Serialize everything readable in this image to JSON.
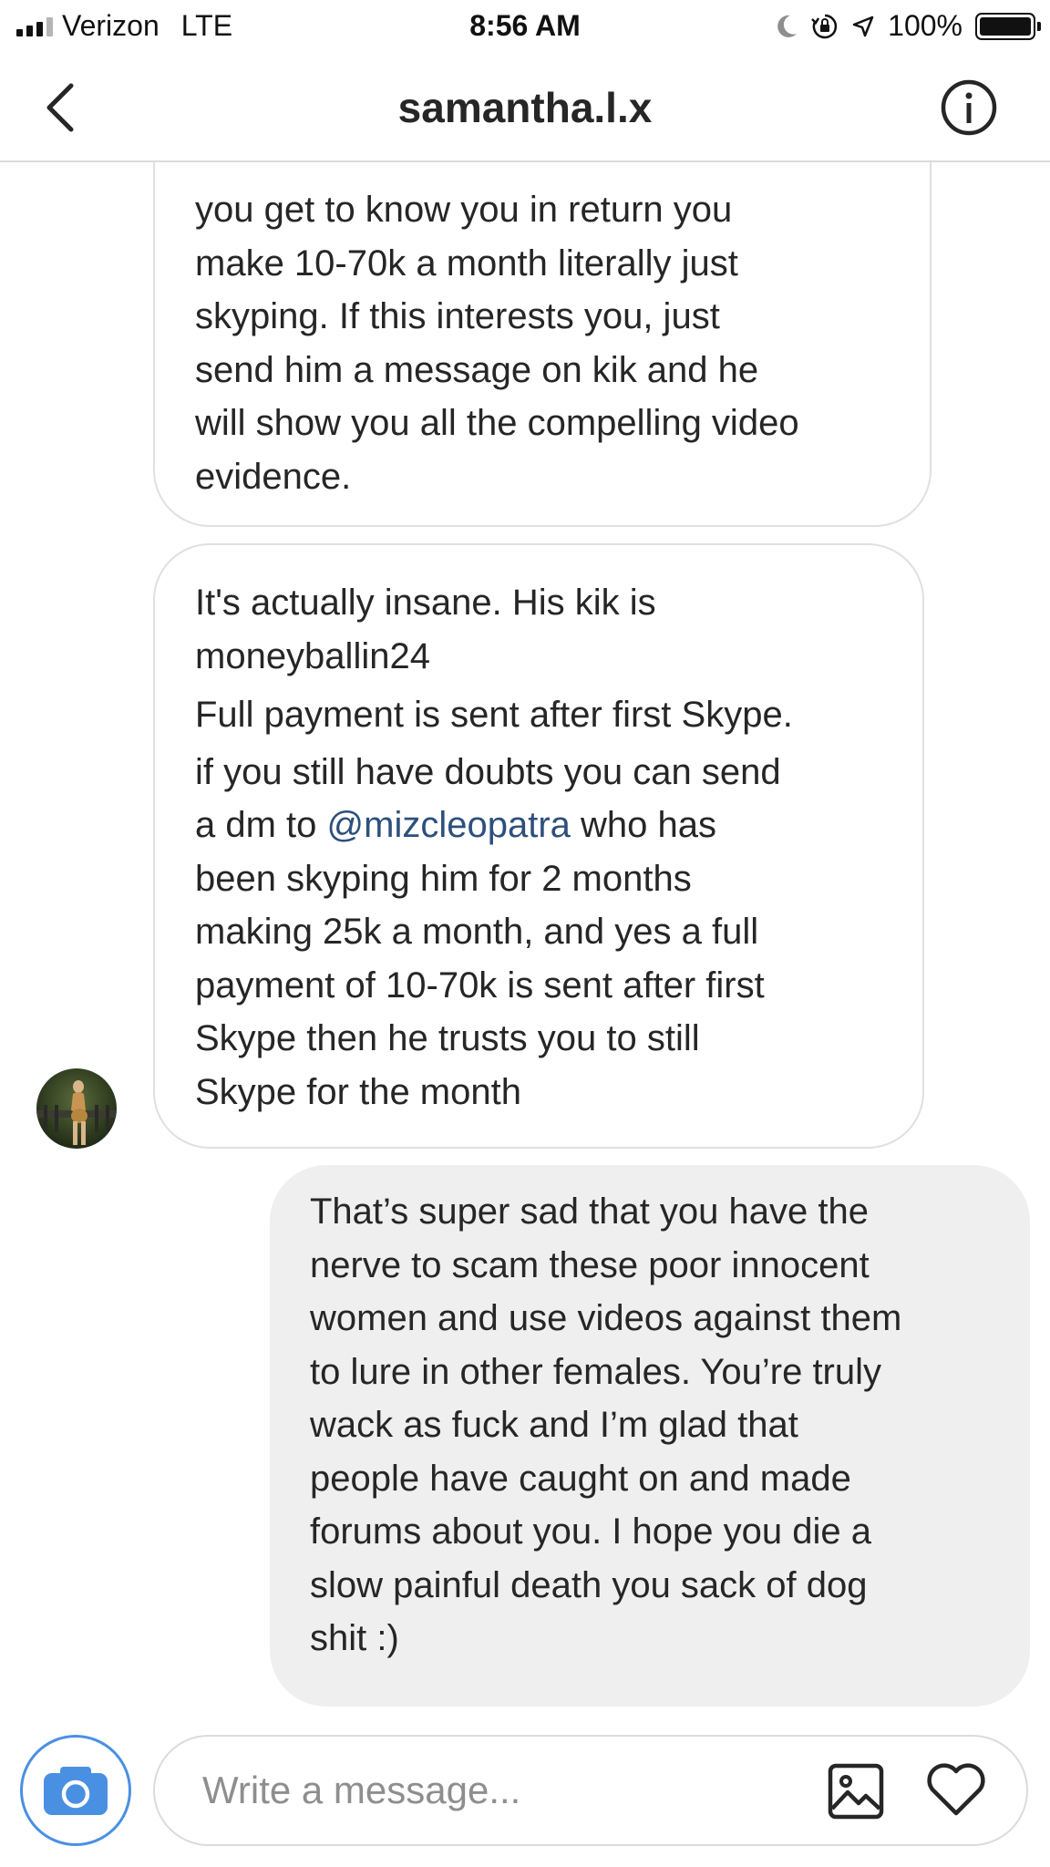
{
  "status_bar": {
    "carrier": "Verizon",
    "network": "LTE",
    "time": "8:56 AM",
    "battery": "100%",
    "battery_level": 1.0,
    "icons": [
      "signal-icon",
      "moon-icon",
      "orientation-lock-icon",
      "location-icon",
      "battery-icon"
    ]
  },
  "header": {
    "title": "samantha.l.x",
    "icons": [
      "back-chevron-icon",
      "info-icon"
    ]
  },
  "messages": [
    {
      "sender": "contact",
      "lines": [
        "you get to know you in return you",
        "make 10-70k a month literally just",
        "skyping. If this interests you, just",
        "send him a message on kik and he",
        "will show you all the compelling video",
        "evidence."
      ]
    },
    {
      "sender": "contact",
      "part1_lines": [
        "It's actually insane. His kik is",
        "moneyballin24"
      ],
      "part2_lines": [
        "Full payment is sent after first Skype."
      ],
      "part3_line_before": "if you still have doubts you can send",
      "part3_mention_prefix": "a dm to ",
      "part3_mention": "@mizcleopatra",
      "part3_mention_suffix": " who has",
      "part3_lines_after": [
        "been skyping him for 2 months",
        "making 25k a month, and yes a full",
        "payment of 10-70k is sent after first",
        "Skype then he trusts you to still",
        "Skype for the month"
      ]
    },
    {
      "sender": "me",
      "lines": [
        "That’s super sad that you have the",
        "nerve to scam these poor innocent",
        "women and use videos against them",
        "to lure in other females. You’re truly",
        "wack as fuck and I’m glad that",
        "people have caught on and made",
        "forums about you. I hope you die a",
        "slow painful death you sack of dog",
        "shit :)"
      ]
    }
  ],
  "composer": {
    "placeholder": "Write a message...",
    "icons": [
      "camera-icon",
      "gallery-icon",
      "heart-icon"
    ]
  },
  "colors": {
    "mention": "#2d4f7c",
    "camera_accent": "#4a90e2",
    "outgoing_bubble": "#efefef",
    "bubble_border": "#e0e0e0"
  }
}
